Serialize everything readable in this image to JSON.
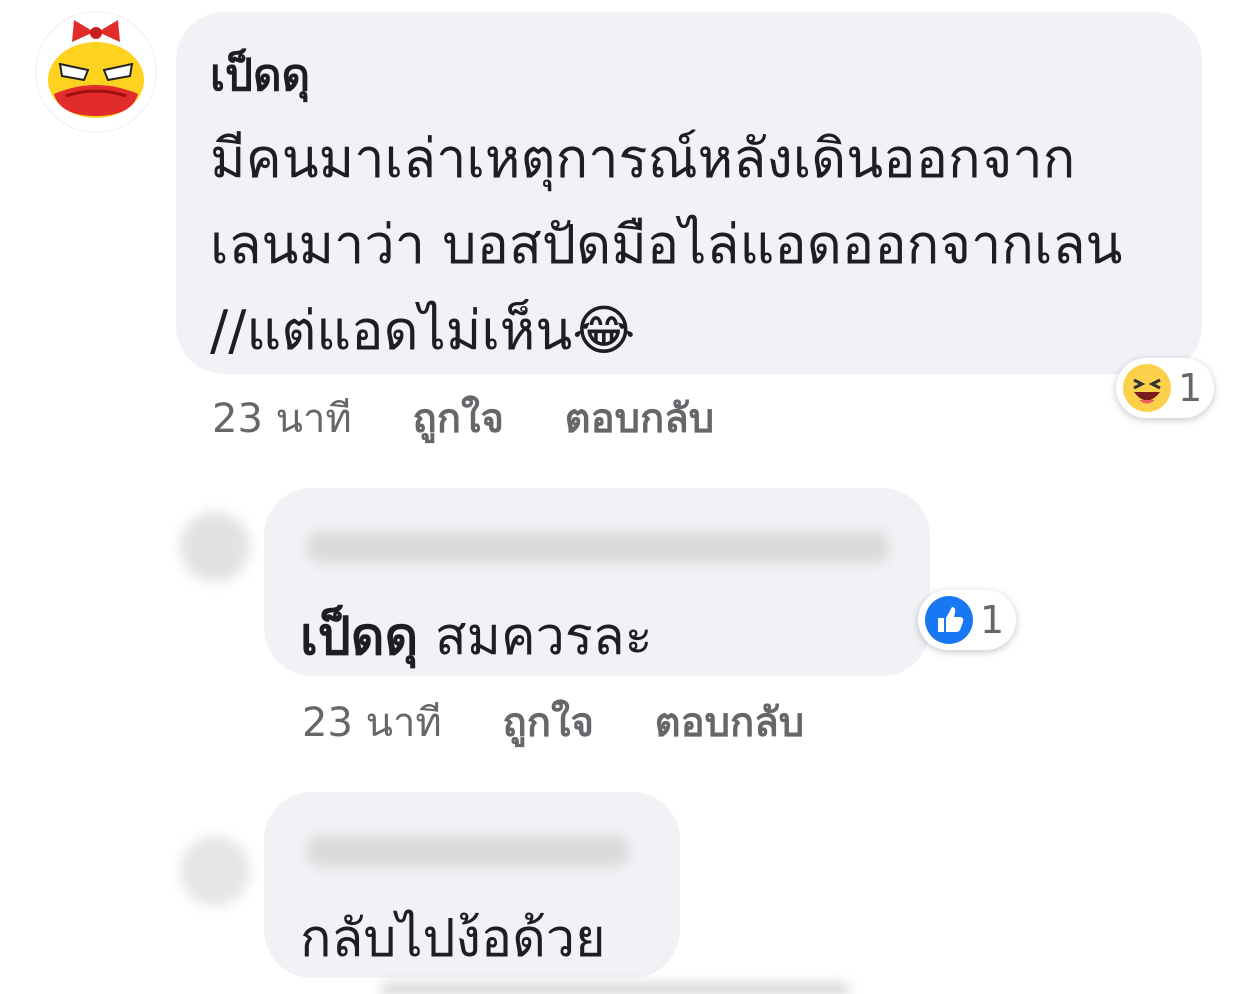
{
  "comment": {
    "author": "เป็ดดุ",
    "lines": [
      "มีคนมาเล่าเหตุการณ์หลังเดินออกจาก",
      "เลนมาว่า บอสปัดมือไล่แอดออกจากเลน",
      "//แต่แอดไม่เห็น"
    ],
    "emoji": "😂",
    "time": "23 นาที",
    "like_label": "ถูกใจ",
    "reply_label": "ตอบกลับ",
    "reaction_icon": "haha-reaction-icon",
    "reaction_count": "1"
  },
  "reply1": {
    "mention": "เป็ดดุ",
    "text": "สมควรละ",
    "time": "23 นาที",
    "like_label": "ถูกใจ",
    "reply_label": "ตอบกลับ",
    "reaction_icon": "like-reaction-icon",
    "reaction_count": "1"
  },
  "reply2": {
    "text": "กลับไปง้อด้วย"
  }
}
